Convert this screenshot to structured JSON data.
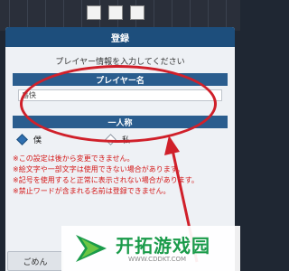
{
  "dialog": {
    "title": "登録",
    "subtitle": "プレイヤー情報を入力してください",
    "name_section": "プレイヤー名",
    "name_value": "島快",
    "pronoun_section": "一人称",
    "pronoun_options": [
      {
        "label": "僕",
        "selected": true
      },
      {
        "label": "私",
        "selected": false
      }
    ],
    "notes": [
      "※この設定は後から変更できません。",
      "※絵文字や一部文字は使用できない場合があります。",
      "※記号を使用すると正常に表示されない場合があります。",
      "※禁止ワードが含まれる名前は登録できません。"
    ],
    "cancel_label": "ごめん"
  },
  "annotation": {
    "color": "#d0202a"
  },
  "watermark": {
    "title": "开拓游戏园",
    "url": "WWW.CDDKT.COM",
    "brand_color": "#1a9b4a"
  }
}
